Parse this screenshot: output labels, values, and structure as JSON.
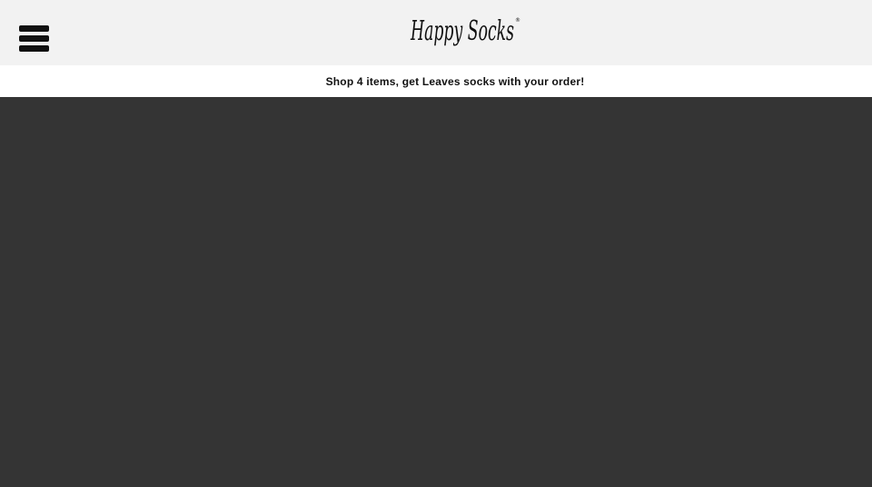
{
  "header": {
    "logo_text": "Happy Socks",
    "logo_mark": "®",
    "menu_icon": "hamburger-menu-icon"
  },
  "promo": {
    "text": "Shop 4 items, get Leaves socks with your order!"
  },
  "colors": {
    "header_bg": "#f2f2f2",
    "promo_bg": "#ffffff",
    "overlay_bg": "#343434",
    "text": "#111111"
  }
}
